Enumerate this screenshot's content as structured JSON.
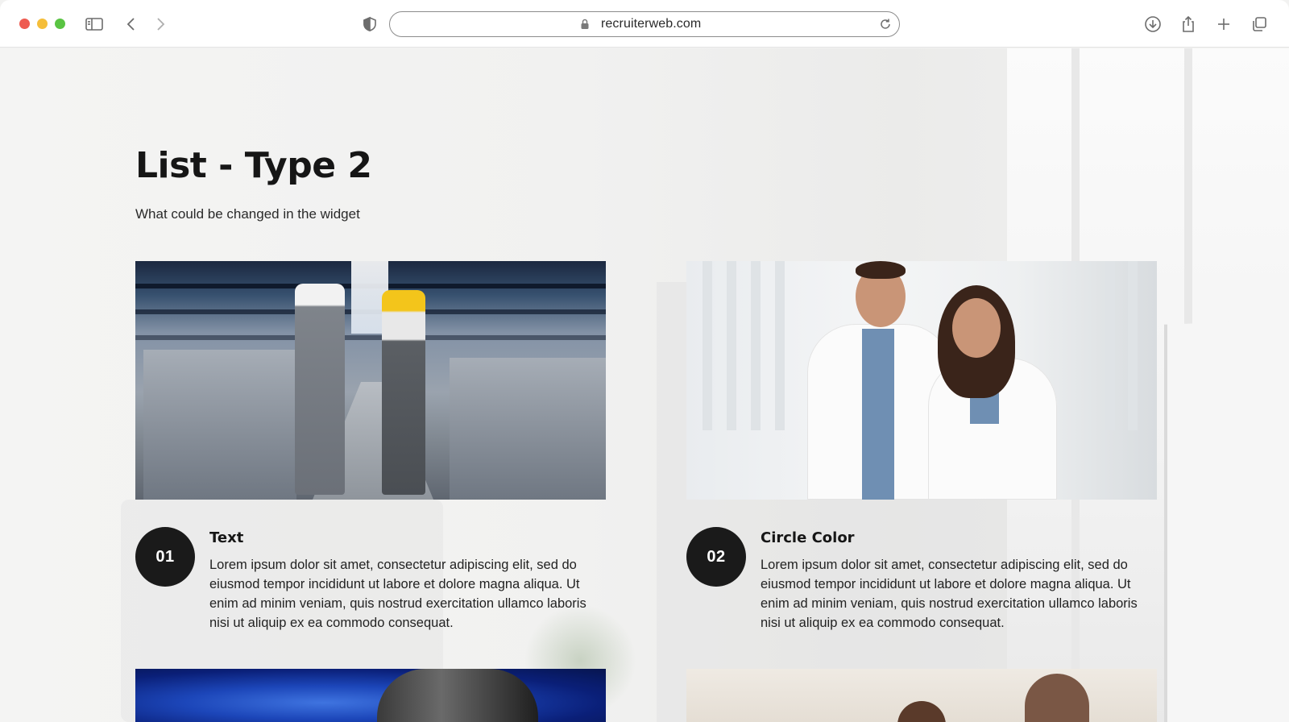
{
  "browser": {
    "url": "recruiterweb.com"
  },
  "page": {
    "title": "List - Type 2",
    "subtitle": "What could be changed in the widget"
  },
  "list_items": [
    {
      "number": "01",
      "title": "Text",
      "body": "Lorem ipsum dolor sit amet, consectetur adipiscing elit, sed do eiusmod tempor incididunt ut labore et dolore magna aliqua. Ut enim ad minim veniam, quis nostrud exercitation ullamco laboris nisi ut aliquip ex ea commodo consequat."
    },
    {
      "number": "02",
      "title": "Circle Color",
      "body": "Lorem ipsum dolor sit amet, consectetur adipiscing elit, sed do eiusmod tempor incididunt ut labore et dolore magna aliqua. Ut enim ad minim veniam, quis nostrud exercitation ullamco laboris nisi ut aliquip ex ea commodo consequat."
    }
  ],
  "colors": {
    "circle": "#1a1a1a",
    "circle_text": "#ffffff",
    "heading": "#161616"
  }
}
